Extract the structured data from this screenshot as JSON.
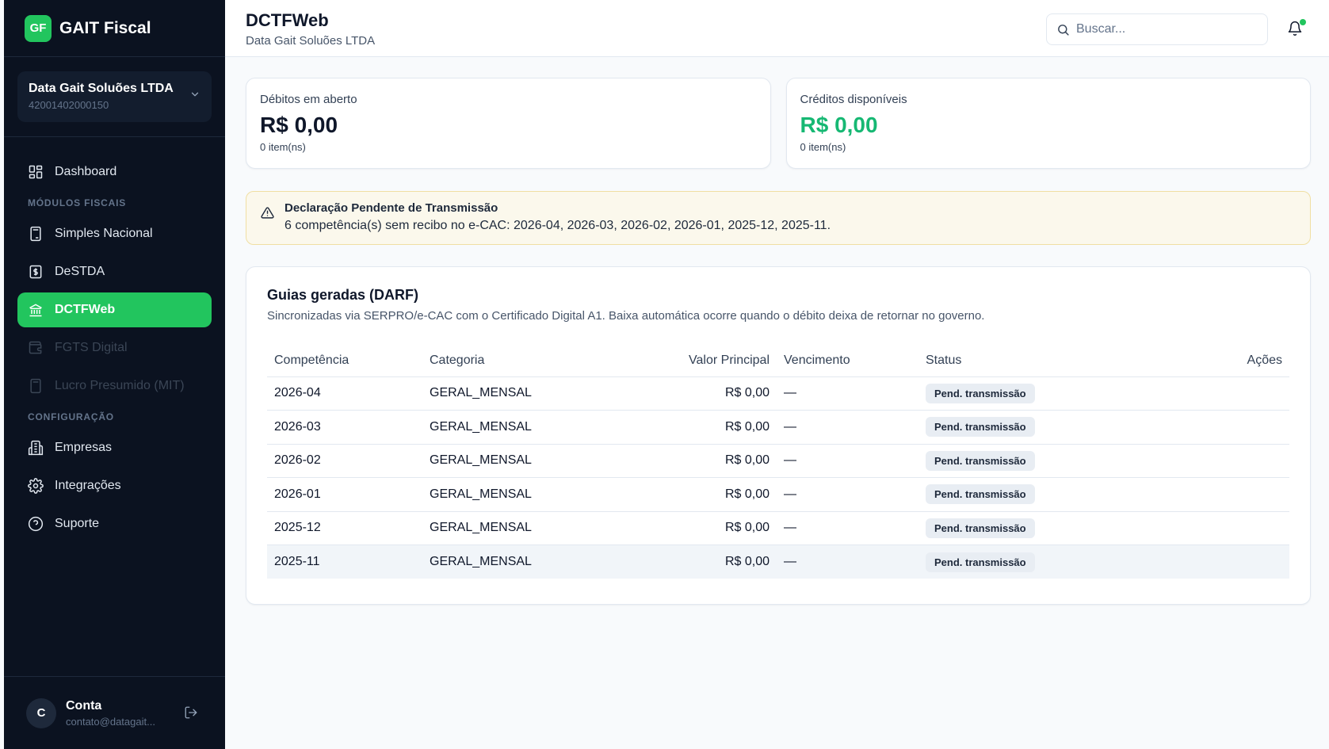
{
  "brand": {
    "logo": "GF",
    "name": "GAIT Fiscal"
  },
  "company": {
    "name": "Data Gait Soluões LTDA",
    "cnpj": "42001402000150"
  },
  "nav": {
    "dashboard": "Dashboard",
    "section_fiscal": "MÓDULOS FISCAIS",
    "simples": "Simples Nacional",
    "destda": "DeSTDA",
    "dctfweb": "DCTFWeb",
    "fgts": "FGTS Digital",
    "lucro": "Lucro Presumido (MIT)",
    "section_config": "CONFIGURAÇÃO",
    "empresas": "Empresas",
    "integracoes": "Integrações",
    "suporte": "Suporte"
  },
  "account": {
    "initial": "C",
    "name": "Conta",
    "email": "contato@datagait..."
  },
  "header": {
    "title": "DCTFWeb",
    "subtitle": "Data Gait Soluões LTDA",
    "search_placeholder": "Buscar..."
  },
  "cards": {
    "debitos": {
      "label": "Débitos em aberto",
      "value": "R$ 0,00",
      "count": "0 item(ns)"
    },
    "creditos": {
      "label": "Créditos disponíveis",
      "value": "R$ 0,00",
      "count": "0 item(ns)"
    }
  },
  "alert": {
    "title": "Declaração Pendente de Transmissão",
    "text": "6 competência(s) sem recibo no e-CAC: 2026-04, 2026-03, 2026-02, 2026-01, 2025-12, 2025-11."
  },
  "guias": {
    "title": "Guias geradas (DARF)",
    "description": "Sincronizadas via SERPRO/e-CAC com o Certificado Digital A1. Baixa automática ocorre quando o débito deixa de retornar no governo.",
    "columns": [
      "Competência",
      "Categoria",
      "Valor Principal",
      "Vencimento",
      "Status",
      "Ações"
    ],
    "rows": [
      {
        "competencia": "2026-04",
        "categoria": "GERAL_MENSAL",
        "valor": "R$ 0,00",
        "vencimento": "—",
        "status": "Pend. transmissão"
      },
      {
        "competencia": "2026-03",
        "categoria": "GERAL_MENSAL",
        "valor": "R$ 0,00",
        "vencimento": "—",
        "status": "Pend. transmissão"
      },
      {
        "competencia": "2026-02",
        "categoria": "GERAL_MENSAL",
        "valor": "R$ 0,00",
        "vencimento": "—",
        "status": "Pend. transmissão"
      },
      {
        "competencia": "2026-01",
        "categoria": "GERAL_MENSAL",
        "valor": "R$ 0,00",
        "vencimento": "—",
        "status": "Pend. transmissão"
      },
      {
        "competencia": "2025-12",
        "categoria": "GERAL_MENSAL",
        "valor": "R$ 0,00",
        "vencimento": "—",
        "status": "Pend. transmissão"
      },
      {
        "competencia": "2025-11",
        "categoria": "GERAL_MENSAL",
        "valor": "R$ 0,00",
        "vencimento": "—",
        "status": "Pend. transmissão"
      }
    ]
  },
  "colors": {
    "accent": "#22c55e",
    "sidebar_bg": "#0b1220",
    "credit_green": "#16b873",
    "alert_bg": "#fbf8ec"
  },
  "icons": [
    "grid-icon",
    "calculator-icon",
    "dollar-doc-icon",
    "bank-icon",
    "wallet-icon",
    "building-icon",
    "gear-icon",
    "help-circle-icon",
    "search-icon",
    "bell-icon",
    "warning-icon",
    "chevron-down-icon",
    "logout-icon"
  ]
}
